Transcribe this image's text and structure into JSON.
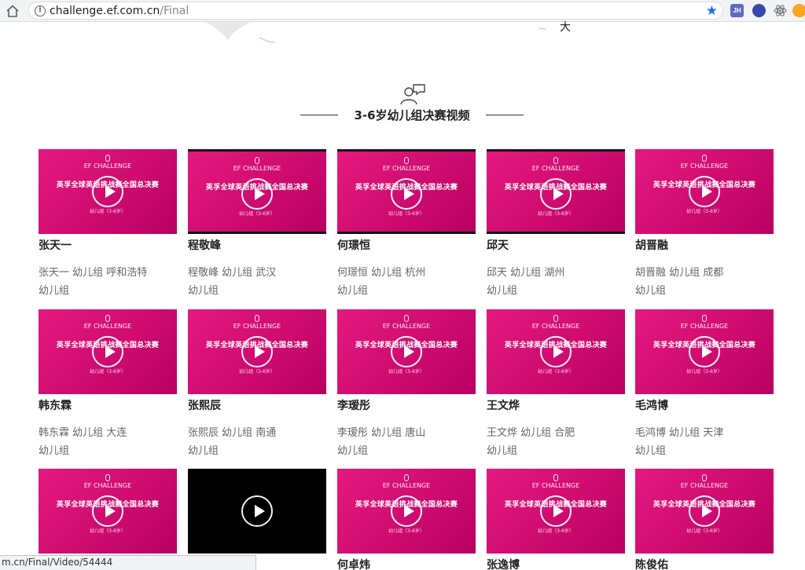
{
  "browser": {
    "url_host": "challenge.ef.com.cn",
    "url_path": "/Final",
    "extensions": [
      "JH"
    ]
  },
  "banner": {
    "glyph": "大"
  },
  "section": {
    "title": "3-6岁幼儿组决赛视频"
  },
  "thumbnail": {
    "brand": "EF CHALLENGE",
    "title": "英孚全球英语挑战赛全国总决赛",
    "group": "幼儿组（3-6岁）"
  },
  "videos": [
    {
      "name": "张天一",
      "desc": "张天一 幼儿组 呼和浩特",
      "group": "幼儿组",
      "style": "pink"
    },
    {
      "name": "程敬峰",
      "desc": "程敬峰 幼儿组 武汉",
      "group": "幼儿组",
      "style": "edged"
    },
    {
      "name": "何璟恒",
      "desc": "何璟恒 幼儿组 杭州",
      "group": "幼儿组",
      "style": "edged"
    },
    {
      "name": "邱天",
      "desc": "邱天 幼儿组 湖州",
      "group": "幼儿组",
      "style": "edged"
    },
    {
      "name": "胡晋融",
      "desc": "胡晋融 幼儿组 成都",
      "group": "幼儿组",
      "style": "pink"
    },
    {
      "name": "韩东霖",
      "desc": "韩东霖 幼儿组 大连",
      "group": "幼儿组",
      "style": "pink"
    },
    {
      "name": "张熙辰",
      "desc": "张熙辰 幼儿组 南通",
      "group": "幼儿组",
      "style": "pink"
    },
    {
      "name": "李瑷彤",
      "desc": "李瑷彤 幼儿组 唐山",
      "group": "幼儿组",
      "style": "pink"
    },
    {
      "name": "王文烨",
      "desc": "王文烨 幼儿组 合肥",
      "group": "幼儿组",
      "style": "pink"
    },
    {
      "name": "毛鸿博",
      "desc": "毛鸿博 幼儿组 天津",
      "group": "幼儿组",
      "style": "pink"
    },
    {
      "name": "",
      "desc": "",
      "group": "",
      "style": "pink"
    },
    {
      "name": "",
      "desc": "",
      "group": "",
      "style": "black"
    },
    {
      "name": "何卓炜",
      "desc": "",
      "group": "",
      "style": "pink"
    },
    {
      "name": "张逸博",
      "desc": "",
      "group": "",
      "style": "pink"
    },
    {
      "name": "陈俊佑",
      "desc": "",
      "group": "",
      "style": "pink"
    }
  ],
  "status_bar": {
    "text": "m.cn/Final/Video/54444"
  },
  "colors": {
    "thumb_pink": "#e5197f",
    "star_blue": "#1a73e8"
  }
}
